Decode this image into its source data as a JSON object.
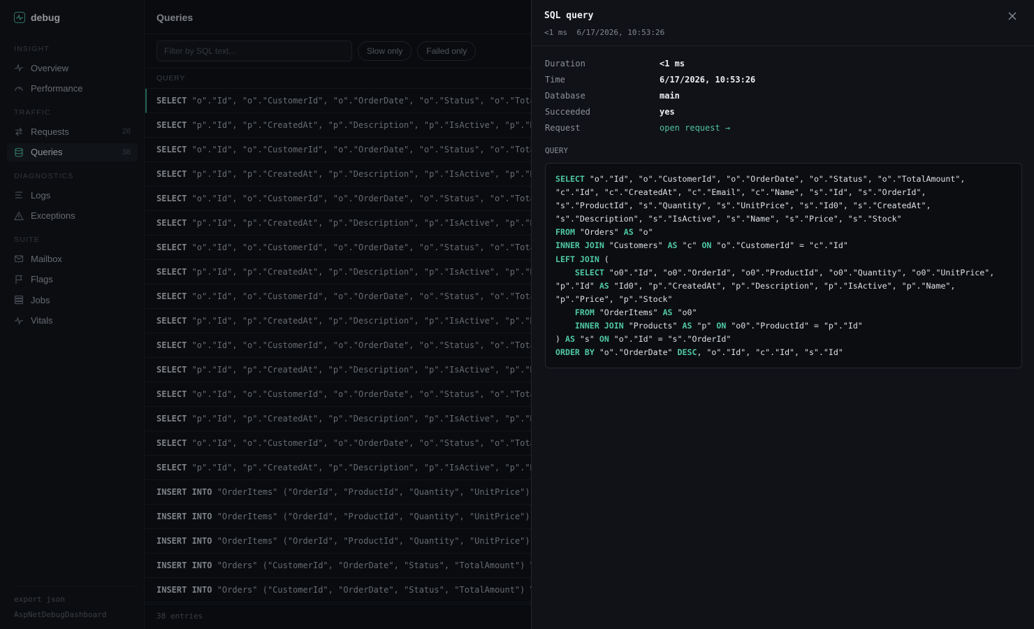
{
  "app": {
    "name": "debug"
  },
  "sidebar": {
    "sections": [
      {
        "label": "INSIGHT",
        "items": [
          {
            "label": "Overview",
            "icon": "pulse-icon"
          },
          {
            "label": "Performance",
            "icon": "gauge-icon"
          }
        ]
      },
      {
        "label": "TRAFFIC",
        "items": [
          {
            "label": "Requests",
            "icon": "arrows-swap-icon",
            "count": "26"
          },
          {
            "label": "Queries",
            "icon": "database-icon",
            "count": "38",
            "active": true
          }
        ]
      },
      {
        "label": "DIAGNOSTICS",
        "items": [
          {
            "label": "Logs",
            "icon": "lines-icon"
          },
          {
            "label": "Exceptions",
            "icon": "warning-icon"
          }
        ]
      },
      {
        "label": "SUITE",
        "items": [
          {
            "label": "Mailbox",
            "icon": "mail-icon"
          },
          {
            "label": "Flags",
            "icon": "flag-icon"
          },
          {
            "label": "Jobs",
            "icon": "stack-icon"
          },
          {
            "label": "Vitals",
            "icon": "heartbeat-icon"
          }
        ]
      }
    ],
    "footer": {
      "export": "export json",
      "product": "AspNetDebugDashboard"
    }
  },
  "main": {
    "title": "Queries",
    "filter_placeholder": "Filter by SQL text...",
    "chips": [
      "Slow only",
      "Failed only"
    ],
    "column": "QUERY",
    "rows": [
      {
        "kw": "SELECT",
        "text": " \"o\".\"Id\", \"o\".\"CustomerId\", \"o\".\"OrderDate\", \"o\".\"Status\", \"o\".\"TotalAmount\""
      },
      {
        "kw": "SELECT",
        "text": " \"p\".\"Id\", \"p\".\"CreatedAt\", \"p\".\"Description\", \"p\".\"IsActive\", \"p\".\"Name\""
      },
      {
        "kw": "SELECT",
        "text": " \"o\".\"Id\", \"o\".\"CustomerId\", \"o\".\"OrderDate\", \"o\".\"Status\", \"o\".\"TotalAmount\""
      },
      {
        "kw": "SELECT",
        "text": " \"p\".\"Id\", \"p\".\"CreatedAt\", \"p\".\"Description\", \"p\".\"IsActive\", \"p\".\"Name\""
      },
      {
        "kw": "SELECT",
        "text": " \"o\".\"Id\", \"o\".\"CustomerId\", \"o\".\"OrderDate\", \"o\".\"Status\", \"o\".\"TotalAmount\""
      },
      {
        "kw": "SELECT",
        "text": " \"p\".\"Id\", \"p\".\"CreatedAt\", \"p\".\"Description\", \"p\".\"IsActive\", \"p\".\"Name\""
      },
      {
        "kw": "SELECT",
        "text": " \"o\".\"Id\", \"o\".\"CustomerId\", \"o\".\"OrderDate\", \"o\".\"Status\", \"o\".\"TotalAmount\""
      },
      {
        "kw": "SELECT",
        "text": " \"p\".\"Id\", \"p\".\"CreatedAt\", \"p\".\"Description\", \"p\".\"IsActive\", \"p\".\"Name\""
      },
      {
        "kw": "SELECT",
        "text": " \"o\".\"Id\", \"o\".\"CustomerId\", \"o\".\"OrderDate\", \"o\".\"Status\", \"o\".\"TotalAmount\""
      },
      {
        "kw": "SELECT",
        "text": " \"p\".\"Id\", \"p\".\"CreatedAt\", \"p\".\"Description\", \"p\".\"IsActive\", \"p\".\"Name\""
      },
      {
        "kw": "SELECT",
        "text": " \"o\".\"Id\", \"o\".\"CustomerId\", \"o\".\"OrderDate\", \"o\".\"Status\", \"o\".\"TotalAmount\""
      },
      {
        "kw": "SELECT",
        "text": " \"p\".\"Id\", \"p\".\"CreatedAt\", \"p\".\"Description\", \"p\".\"IsActive\", \"p\".\"Name\""
      },
      {
        "kw": "SELECT",
        "text": " \"o\".\"Id\", \"o\".\"CustomerId\", \"o\".\"OrderDate\", \"o\".\"Status\", \"o\".\"TotalAmount\""
      },
      {
        "kw": "SELECT",
        "text": " \"p\".\"Id\", \"p\".\"CreatedAt\", \"p\".\"Description\", \"p\".\"IsActive\", \"p\".\"Name\""
      },
      {
        "kw": "SELECT",
        "text": " \"o\".\"Id\", \"o\".\"CustomerId\", \"o\".\"OrderDate\", \"o\".\"Status\", \"o\".\"TotalAmount\""
      },
      {
        "kw": "SELECT",
        "text": " \"p\".\"Id\", \"p\".\"CreatedAt\", \"p\".\"Description\", \"p\".\"IsActive\", \"p\".\"Name\""
      },
      {
        "kw": "INSERT INTO",
        "text": " \"OrderItems\" (\"OrderId\", \"ProductId\", \"Quantity\", \"UnitPrice\") VALUES"
      },
      {
        "kw": "INSERT INTO",
        "text": " \"OrderItems\" (\"OrderId\", \"ProductId\", \"Quantity\", \"UnitPrice\") VALUES"
      },
      {
        "kw": "INSERT INTO",
        "text": " \"OrderItems\" (\"OrderId\", \"ProductId\", \"Quantity\", \"UnitPrice\") VALUES"
      },
      {
        "kw": "INSERT INTO",
        "text": " \"Orders\" (\"CustomerId\", \"OrderDate\", \"Status\", \"TotalAmount\") VALUES"
      },
      {
        "kw": "INSERT INTO",
        "text": " \"Orders\" (\"CustomerId\", \"OrderDate\", \"Status\", \"TotalAmount\") VALUES"
      }
    ],
    "footer": "38 entries"
  },
  "drawer": {
    "title": "SQL query",
    "subtitle": "<1 ms  6/17/2026, 10:53:26",
    "details": [
      {
        "key": "Duration",
        "value": "<1 ms"
      },
      {
        "key": "Time",
        "value": "6/17/2026, 10:53:26"
      },
      {
        "key": "Database",
        "value": "main"
      },
      {
        "key": "Succeeded",
        "value": "yes"
      },
      {
        "key": "Request",
        "value": "open request →",
        "link": true
      }
    ],
    "query_label": "QUERY",
    "sql_lines": [
      [
        [
          "kw",
          "SELECT"
        ],
        [
          "t",
          " \"o\".\"Id\", \"o\".\"CustomerId\", \"o\".\"OrderDate\", \"o\".\"Status\", \"o\".\"TotalAmount\","
        ]
      ],
      [
        [
          "t",
          "\"c\".\"Id\", \"c\".\"CreatedAt\", \"c\".\"Email\", \"c\".\"Name\", \"s\".\"Id\", \"s\".\"OrderId\","
        ]
      ],
      [
        [
          "t",
          "\"s\".\"ProductId\", \"s\".\"Quantity\", \"s\".\"UnitPrice\", \"s\".\"Id0\", \"s\".\"CreatedAt\","
        ]
      ],
      [
        [
          "t",
          "\"s\".\"Description\", \"s\".\"IsActive\", \"s\".\"Name\", \"s\".\"Price\", \"s\".\"Stock\""
        ]
      ],
      [
        [
          "kw",
          "FROM"
        ],
        [
          "t",
          " \"Orders\" "
        ],
        [
          "kw",
          "AS"
        ],
        [
          "t",
          " \"o\""
        ]
      ],
      [
        [
          "kw",
          "INNER JOIN"
        ],
        [
          "t",
          " \"Customers\" "
        ],
        [
          "kw",
          "AS"
        ],
        [
          "t",
          " \"c\" "
        ],
        [
          "kw",
          "ON"
        ],
        [
          "t",
          " \"o\".\"CustomerId\" = \"c\".\"Id\""
        ]
      ],
      [
        [
          "kw",
          "LEFT JOIN"
        ],
        [
          "t",
          " ("
        ]
      ],
      [
        [
          "t",
          "    "
        ],
        [
          "kw",
          "SELECT"
        ],
        [
          "t",
          " \"o0\".\"Id\", \"o0\".\"OrderId\", \"o0\".\"ProductId\", \"o0\".\"Quantity\", \"o0\".\"UnitPrice\","
        ]
      ],
      [
        [
          "t",
          "\"p\".\"Id\" "
        ],
        [
          "kw",
          "AS"
        ],
        [
          "t",
          " \"Id0\", \"p\".\"CreatedAt\", \"p\".\"Description\", \"p\".\"IsActive\", \"p\".\"Name\","
        ]
      ],
      [
        [
          "t",
          "\"p\".\"Price\", \"p\".\"Stock\""
        ]
      ],
      [
        [
          "t",
          "    "
        ],
        [
          "kw",
          "FROM"
        ],
        [
          "t",
          " \"OrderItems\" "
        ],
        [
          "kw",
          "AS"
        ],
        [
          "t",
          " \"o0\""
        ]
      ],
      [
        [
          "t",
          "    "
        ],
        [
          "kw",
          "INNER JOIN"
        ],
        [
          "t",
          " \"Products\" "
        ],
        [
          "kw",
          "AS"
        ],
        [
          "t",
          " \"p\" "
        ],
        [
          "kw",
          "ON"
        ],
        [
          "t",
          " \"o0\".\"ProductId\" = \"p\".\"Id\""
        ]
      ],
      [
        [
          "t",
          ") "
        ],
        [
          "kw",
          "AS"
        ],
        [
          "t",
          " \"s\" "
        ],
        [
          "kw",
          "ON"
        ],
        [
          "t",
          " \"o\".\"Id\" = \"s\".\"OrderId\""
        ]
      ],
      [
        [
          "kw",
          "ORDER BY"
        ],
        [
          "t",
          " \"o\".\"OrderDate\" "
        ],
        [
          "kw",
          "DESC"
        ],
        [
          "t",
          ", \"o\".\"Id\", \"c\".\"Id\", \"s\".\"Id\""
        ]
      ]
    ]
  },
  "colors": {
    "accent": "#4fc9a4",
    "background": "#0c0e12",
    "drawer": "#101217"
  }
}
